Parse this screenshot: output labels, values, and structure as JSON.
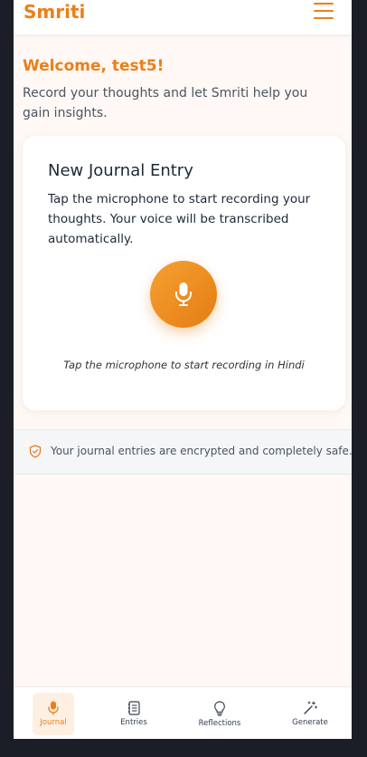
{
  "app": {
    "name": "Smriti"
  },
  "header": {
    "menu_icon": "hamburger-menu-icon"
  },
  "welcome": {
    "title": "Welcome, test5!",
    "subtitle": "Record your thoughts and let Smriti help you gain insights."
  },
  "entry_card": {
    "title": "New Journal Entry",
    "description": "Tap the microphone to start recording your thoughts. Your voice will be transcribed automatically.",
    "mic_icon": "microphone-icon",
    "hint": "Tap the microphone to start recording in Hindi"
  },
  "security": {
    "icon": "shield-check-icon",
    "text": "Your journal entries are encrypted and completely safe."
  },
  "nav": {
    "items": [
      {
        "label": "Journal",
        "icon": "microphone-icon",
        "active": true
      },
      {
        "label": "Entries",
        "icon": "notebook-icon",
        "active": false
      },
      {
        "label": "Reflections",
        "icon": "lightbulb-icon",
        "active": false
      },
      {
        "label": "Generate",
        "icon": "magic-wand-icon",
        "active": false
      }
    ]
  },
  "colors": {
    "accent": "#ea7f1a",
    "background": "#fff8f4",
    "frame": "#1b1e27"
  }
}
